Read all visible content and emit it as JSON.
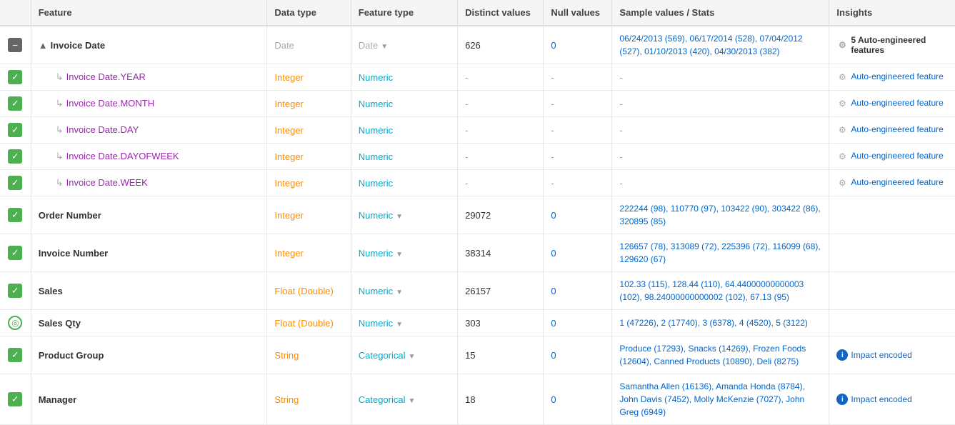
{
  "header": {
    "cols": [
      "Feature",
      "Data type",
      "Feature type",
      "Distinct values",
      "Null values",
      "Sample values / Stats",
      "Insights"
    ]
  },
  "rows": [
    {
      "id": "invoice-date",
      "checkbox": "minus",
      "feature": "Invoice Date",
      "expand": true,
      "feature_indent": false,
      "datatype": "Date",
      "datatype_class": "type-date",
      "featuretype": "Date",
      "featuretype_class": "feature-date-faded",
      "featuretype_dropdown": true,
      "distinct": "626",
      "null": "0",
      "null_class": "null-zero",
      "sample": "06/24/2013 (569), 06/17/2014 (528), 07/04/2012 (527), 01/10/2013 (420), 04/30/2013 (382)",
      "insights_type": "bold",
      "insights_text": "5 Auto-engineered features",
      "insights_icon": "gear"
    },
    {
      "id": "invoice-date-year",
      "checkbox": "green",
      "feature": "Invoice Date.YEAR",
      "sub": true,
      "feature_indent": true,
      "datatype": "Integer",
      "datatype_class": "type-integer",
      "featuretype": "Numeric",
      "featuretype_class": "feature-numeric",
      "featuretype_dropdown": false,
      "distinct": "-",
      "null": "-",
      "null_class": "dash",
      "sample": "-",
      "insights_type": "auto",
      "insights_text": "Auto-engineered feature"
    },
    {
      "id": "invoice-date-month",
      "checkbox": "green",
      "feature": "Invoice Date.MONTH",
      "sub": true,
      "feature_indent": true,
      "datatype": "Integer",
      "datatype_class": "type-integer",
      "featuretype": "Numeric",
      "featuretype_class": "feature-numeric",
      "featuretype_dropdown": false,
      "distinct": "-",
      "null": "-",
      "null_class": "dash",
      "sample": "-",
      "insights_type": "auto",
      "insights_text": "Auto-engineered feature"
    },
    {
      "id": "invoice-date-day",
      "checkbox": "green",
      "feature": "Invoice Date.DAY",
      "sub": true,
      "feature_indent": true,
      "datatype": "Integer",
      "datatype_class": "type-integer",
      "featuretype": "Numeric",
      "featuretype_class": "feature-numeric",
      "featuretype_dropdown": false,
      "distinct": "-",
      "null": "-",
      "null_class": "dash",
      "sample": "-",
      "insights_type": "auto",
      "insights_text": "Auto-engineered feature"
    },
    {
      "id": "invoice-date-dayofweek",
      "checkbox": "green",
      "feature": "Invoice Date.DAYOFWEEK",
      "sub": true,
      "feature_indent": true,
      "datatype": "Integer",
      "datatype_class": "type-integer",
      "featuretype": "Numeric",
      "featuretype_class": "feature-numeric",
      "featuretype_dropdown": false,
      "distinct": "-",
      "null": "-",
      "null_class": "dash",
      "sample": "-",
      "insights_type": "auto",
      "insights_text": "Auto-engineered feature"
    },
    {
      "id": "invoice-date-week",
      "checkbox": "green",
      "feature": "Invoice Date.WEEK",
      "sub": true,
      "feature_indent": true,
      "datatype": "Integer",
      "datatype_class": "type-integer",
      "featuretype": "Numeric",
      "featuretype_class": "feature-numeric",
      "featuretype_dropdown": false,
      "distinct": "-",
      "null": "-",
      "null_class": "dash",
      "sample": "-",
      "insights_type": "auto",
      "insights_text": "Auto-engineered feature"
    },
    {
      "id": "order-number",
      "checkbox": "green",
      "feature": "Order Number",
      "sub": false,
      "feature_indent": false,
      "datatype": "Integer",
      "datatype_class": "type-integer",
      "featuretype": "Numeric",
      "featuretype_class": "feature-numeric",
      "featuretype_dropdown": true,
      "distinct": "29072",
      "null": "0",
      "null_class": "null-zero",
      "sample": "222244 (98), 110770 (97), 103422 (90), 303422 (86), 320895 (85)",
      "insights_type": "none"
    },
    {
      "id": "invoice-number",
      "checkbox": "green",
      "feature": "Invoice Number",
      "sub": false,
      "feature_indent": false,
      "datatype": "Integer",
      "datatype_class": "type-integer",
      "featuretype": "Numeric",
      "featuretype_class": "feature-numeric",
      "featuretype_dropdown": true,
      "distinct": "38314",
      "null": "0",
      "null_class": "null-zero",
      "sample": "126657 (78), 313089 (72), 225396 (72), 116099 (68), 129620 (67)",
      "insights_type": "none"
    },
    {
      "id": "sales",
      "checkbox": "green",
      "feature": "Sales",
      "sub": false,
      "feature_indent": false,
      "datatype": "Float (Double)",
      "datatype_class": "type-float",
      "featuretype": "Numeric",
      "featuretype_class": "feature-numeric",
      "featuretype_dropdown": true,
      "distinct": "26157",
      "null": "0",
      "null_class": "null-zero",
      "sample": "102.33 (115), 128.44 (110), 64.44000000000003 (102), 98.24000000000002 (102), 67.13 (95)",
      "insights_type": "none"
    },
    {
      "id": "sales-qty",
      "checkbox": "target",
      "feature": "Sales Qty",
      "sub": false,
      "feature_indent": false,
      "datatype": "Float (Double)",
      "datatype_class": "type-float",
      "featuretype": "Numeric",
      "featuretype_class": "feature-numeric",
      "featuretype_dropdown": true,
      "distinct": "303",
      "null": "0",
      "null_class": "null-zero",
      "sample": "1 (47226), 2 (17740), 3 (6378), 4 (4520), 5 (3122)",
      "insights_type": "none"
    },
    {
      "id": "product-group",
      "checkbox": "green",
      "feature": "Product Group",
      "sub": false,
      "feature_indent": false,
      "datatype": "String",
      "datatype_class": "type-string",
      "featuretype": "Categorical",
      "featuretype_class": "feature-categorical",
      "featuretype_dropdown": true,
      "distinct": "15",
      "null": "0",
      "null_class": "null-zero",
      "sample": "Produce (17293), Snacks (14269), Frozen Foods (12604), Canned Products (10890), Deli (8275)",
      "insights_type": "impact",
      "insights_text": "Impact encoded"
    },
    {
      "id": "manager",
      "checkbox": "green",
      "feature": "Manager",
      "sub": false,
      "feature_indent": false,
      "datatype": "String",
      "datatype_class": "type-string",
      "featuretype": "Categorical",
      "featuretype_class": "feature-categorical",
      "featuretype_dropdown": true,
      "distinct": "18",
      "null": "0",
      "null_class": "null-zero",
      "sample": "Samantha Allen (16136), Amanda Honda (8784), John Davis (7452), Molly McKenzie (7027), John Greg (6949)",
      "insights_type": "impact",
      "insights_text": "Impact encoded"
    }
  ]
}
